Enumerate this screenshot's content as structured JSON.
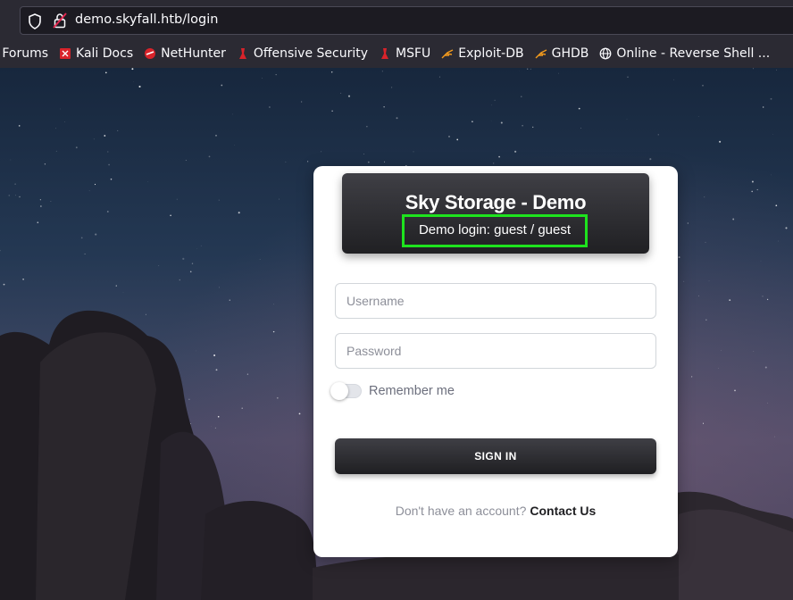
{
  "browser": {
    "url": "demo.skyfall.htb/login",
    "bookmarks": [
      {
        "label": "i Forums",
        "icon": "forum-icon"
      },
      {
        "label": "Kali Docs",
        "icon": "kali-docs-icon"
      },
      {
        "label": "NetHunter",
        "icon": "nethunter-icon"
      },
      {
        "label": "Offensive Security",
        "icon": "offsec-icon"
      },
      {
        "label": "MSFU",
        "icon": "msfu-icon"
      },
      {
        "label": "Exploit-DB",
        "icon": "exploitdb-icon"
      },
      {
        "label": "GHDB",
        "icon": "ghdb-icon"
      },
      {
        "label": "Online - Reverse Shell ...",
        "icon": "globe-icon"
      }
    ]
  },
  "login": {
    "title": "Sky Storage - Demo",
    "subtitle": "Demo login: guest / guest",
    "username_placeholder": "Username",
    "password_placeholder": "Password",
    "remember_label": "Remember me",
    "signin_label": "SIGN IN",
    "account_text": "Don't have an account?",
    "contact_label": "Contact Us"
  },
  "colors": {
    "highlight": "#1ee31e",
    "header_dark": "#202023"
  }
}
